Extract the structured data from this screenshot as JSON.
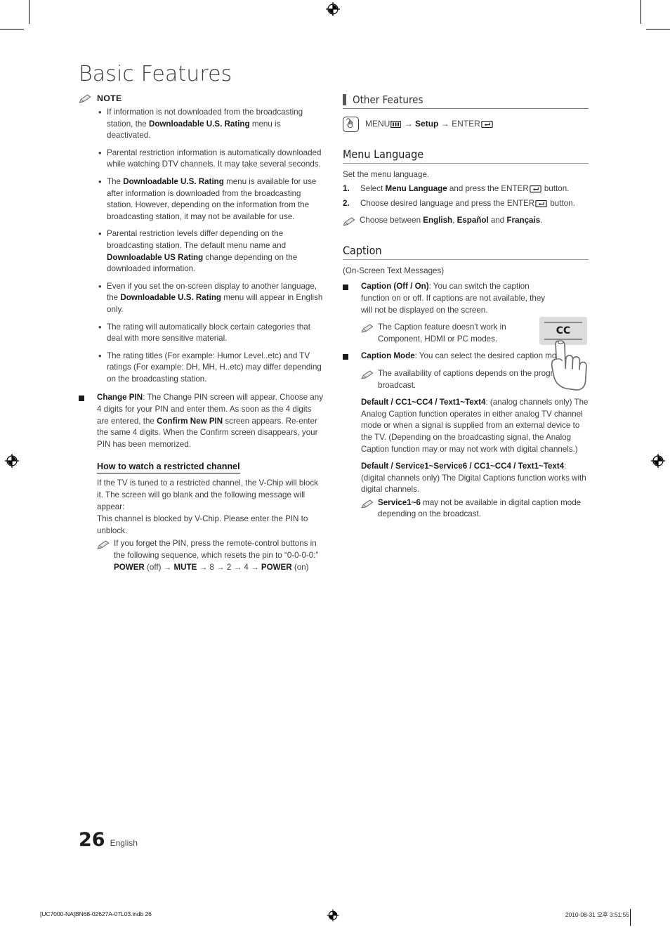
{
  "document": {
    "chapter_title": "Basic Features",
    "page_number": "26",
    "page_language": "English"
  },
  "left_column": {
    "note_label": "NOTE",
    "note_icon": "pencil-icon",
    "note_bullets": [
      "If information is not downloaded from the broadcasting station, the <b>Downloadable U.S. Rating</b> menu is deactivated.",
      "Parental restriction information is automatically downloaded while watching DTV channels. It may take several seconds.",
      "The <b>Downloadable U.S. Rating</b> menu is available for use after information is downloaded from the broadcasting station. However, depending on the information from the broadcasting station, it may not be available for use.",
      "Parental restriction levels differ depending on the broadcasting station. The default menu name and <b>Downloadable US Rating</b> change depending on the downloaded information.",
      "Even if you set the on-screen display to another language, the <b>Downloadable U.S. Rating</b> menu will appear in English only.",
      "The rating will automatically block certain categories that deal with more sensitive material.",
      "The rating titles (For example: Humor Level..etc) and TV ratings (For example: DH, MH, H..etc) may differ depending on the broadcasting station."
    ],
    "change_pin": {
      "bullet_icon": "square-bullet-icon",
      "text": "<b>Change PIN</b>: The Change PIN screen will appear. Choose any 4 digits for your PIN and enter them. As soon as the 4 digits are entered, the <b>Confirm New PIN</b> screen appears. Re-enter the same 4 digits. When the Confirm screen disappears, your PIN has been memorized."
    },
    "restricted_channel": {
      "heading": "How to watch a restricted channel",
      "paragraph_1": "If the TV is tuned to a restricted channel, the V-Chip will block it. The screen will go blank and the following message will appear:",
      "paragraph_2": "This channel is blocked by V-Chip. Please enter the PIN to unblock.",
      "note_icon": "pencil-icon",
      "note": "If you forget the PIN, press the remote-control buttons in the following sequence, which resets the pin to &ldquo;0-0-0-0:&rdquo; <b>POWER</b> (off) &rarr; <b>MUTE</b> &rarr; 8 &rarr; 2 &rarr; 4 &rarr; <b>POWER</b> (on)"
    }
  },
  "right_column": {
    "section_header": "Other Features",
    "menu_path": {
      "icon": "hand-press-icon",
      "prefix": "MENU",
      "menu_key_icon": "menu-key-icon",
      "arrow_1": "→",
      "middle": "Setup",
      "arrow_2": "→",
      "suffix": "ENTER",
      "enter_key_icon": "enter-key-icon"
    },
    "menu_language": {
      "heading": "Menu Language",
      "intro": "Set the menu language.",
      "steps": [
        {
          "num": "1.",
          "text": "Select <b>Menu Language</b> and press the ENTER<span class=\"ekey\"></span> button."
        },
        {
          "num": "2.",
          "text": "Choose desired language and press the ENTER<span class=\"ekey\"></span> button."
        }
      ],
      "note_icon": "pencil-icon",
      "note": "Choose between <b>English</b>, <b>Espa&ntilde;ol</b> and <b>Fran&ccedil;ais</b>."
    },
    "caption": {
      "heading": "Caption",
      "subtitle": "(On-Screen Text Messages)",
      "items": [
        {
          "bullet_icon": "square-bullet-icon",
          "text": "<b>Caption (Off / On)</b>: You can switch the caption function on or off. If captions are not available, they will not be displayed on the screen.",
          "note_icon": "pencil-icon",
          "note": "The Caption feature doesn't work in Component, HDMI or PC modes."
        },
        {
          "bullet_icon": "square-bullet-icon",
          "text": "<b>Caption Mode</b>: You can select the desired caption mode.",
          "note_icon": "pencil-icon",
          "note": "The availability of captions depends on the program being broadcast."
        }
      ],
      "analog_modes": "<b>Default / CC1~CC4 / Text1~Text4</b>: (analog channels only) The Analog Caption function operates in either analog TV channel mode or when a signal is supplied from an external device to the TV. (Depending on the broadcasting signal, the Analog Caption function may or may not work with digital channels.)",
      "digital_modes": "<b>Default / Service1~Service6 / CC1~CC4 / Text1~Text4</b>: (digital channels only) The Digital Captions function works with digital channels.",
      "digital_note_icon": "pencil-icon",
      "digital_note": "<b>Service1~6</b> may not be available in digital caption mode depending on the broadcast."
    },
    "cc_illustration": {
      "button_label": "CC",
      "icon": "hand-pointing-cc-button"
    }
  },
  "footer": {
    "file_name": "[UC7000-NA]BN68-02627A-07L03.indb   26",
    "timestamp": "2010-08-31   오후 3:51:55",
    "registration_icon": "registration-target-icon"
  },
  "colors": {
    "body_text": "#3c3c3c",
    "bold_text": "#1b1b1b",
    "section_bar": "#575757",
    "rule": "#7d7d7d",
    "cc_button_fill": "#dcdcdc"
  }
}
